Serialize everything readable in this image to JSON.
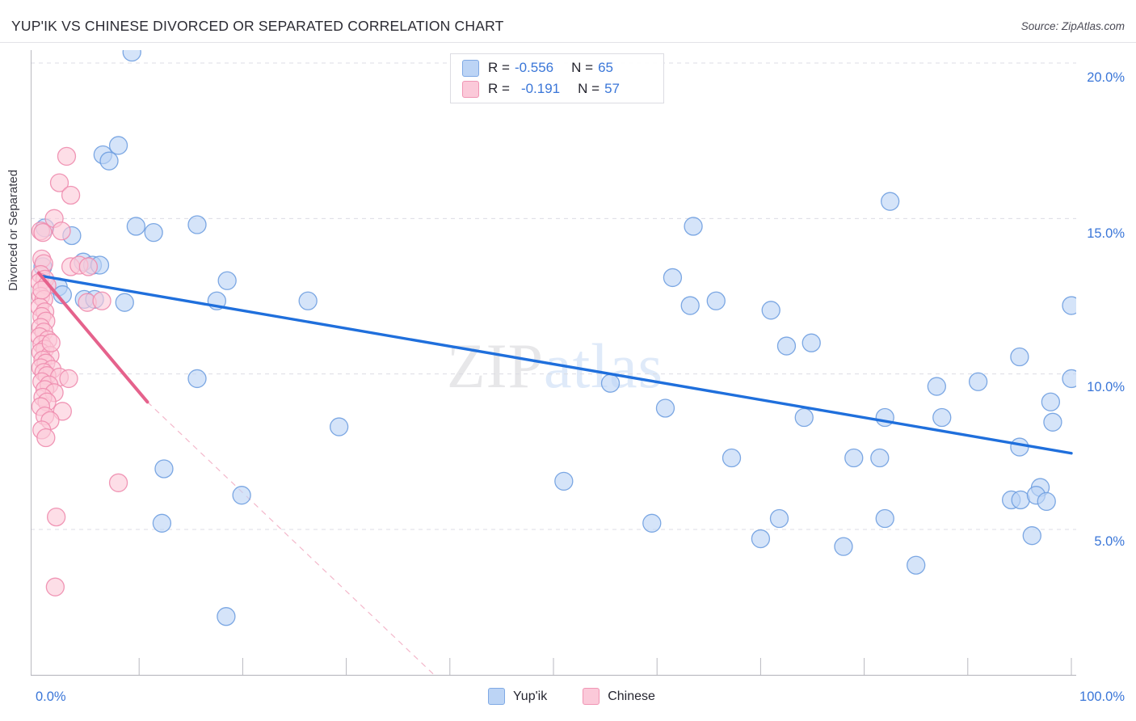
{
  "header": {
    "title": "YUP'IK VS CHINESE DIVORCED OR SEPARATED CORRELATION CHART",
    "source": "Source: ZipAtlas.com"
  },
  "watermark": {
    "part1": "ZIP",
    "part2": "atlas"
  },
  "legend": {
    "rows": [
      {
        "series": "Yup'ik",
        "r_key": "R =",
        "r_value": "-0.556",
        "n_key": "N =",
        "n_value": "65",
        "color": "#bcd4f5"
      },
      {
        "series": "Chinese",
        "r_key": "R =",
        "r_value": "-0.191",
        "n_key": "N =",
        "n_value": "57",
        "color": "#fbc9d9"
      }
    ]
  },
  "bottom_legend": [
    {
      "label": "Yup'ik",
      "color": "#bcd4f5"
    },
    {
      "label": "Chinese",
      "color": "#fbc9d9"
    }
  ],
  "axes": {
    "y_title": "Divorced or Separated",
    "y_ticks": [
      "20.0%",
      "15.0%",
      "10.0%",
      "5.0%"
    ],
    "x_ticks": [
      "0.0%",
      "100.0%"
    ]
  },
  "chart_data": {
    "type": "scatter",
    "title": "YUP'IK VS CHINESE DIVORCED OR SEPARATED CORRELATION CHART",
    "xlabel": "",
    "ylabel": "Divorced or Separated",
    "xlim": [
      0,
      100
    ],
    "ylim": [
      0,
      21.5
    ],
    "x_unit": "%",
    "y_unit": "%",
    "grid": "horizontal-dashed",
    "legend_position": "top-center",
    "y_gridlines": [
      20.0,
      15.0,
      10.0,
      5.0
    ],
    "x_tick_positions": [
      0,
      10,
      20,
      30,
      40,
      50,
      60,
      70,
      80,
      90,
      100
    ],
    "series": [
      {
        "name": "Yup'ik",
        "color": "#bcd4f5",
        "edge": "#6f9fe0",
        "R": -0.556,
        "N": 65,
        "trend": {
          "type": "linear",
          "x0": 0.6,
          "y0": 13.15,
          "x1": 100.0,
          "y1": 7.45,
          "color": "#1f6fdc",
          "dashed_extension": false
        },
        "points": [
          [
            9.3,
            20.35
          ],
          [
            8.0,
            17.35
          ],
          [
            6.5,
            17.05
          ],
          [
            7.1,
            16.85
          ],
          [
            0.9,
            14.7
          ],
          [
            3.5,
            14.45
          ],
          [
            9.7,
            14.75
          ],
          [
            11.4,
            14.55
          ],
          [
            15.6,
            14.8
          ],
          [
            0.7,
            13.45
          ],
          [
            4.6,
            13.6
          ],
          [
            5.5,
            13.5
          ],
          [
            6.2,
            13.5
          ],
          [
            18.5,
            13.0
          ],
          [
            2.2,
            12.8
          ],
          [
            2.6,
            12.55
          ],
          [
            4.7,
            12.4
          ],
          [
            5.7,
            12.4
          ],
          [
            8.6,
            12.3
          ],
          [
            17.5,
            12.35
          ],
          [
            26.3,
            12.35
          ],
          [
            63.5,
            14.75
          ],
          [
            61.5,
            13.1
          ],
          [
            82.5,
            15.55
          ],
          [
            63.2,
            12.2
          ],
          [
            65.7,
            12.35
          ],
          [
            71.0,
            12.05
          ],
          [
            100.0,
            12.2
          ],
          [
            72.5,
            10.9
          ],
          [
            74.9,
            11.0
          ],
          [
            95.0,
            10.55
          ],
          [
            100.0,
            9.85
          ],
          [
            15.6,
            9.85
          ],
          [
            87.0,
            9.6
          ],
          [
            91.0,
            9.75
          ],
          [
            98.0,
            9.1
          ],
          [
            55.5,
            9.7
          ],
          [
            60.8,
            8.9
          ],
          [
            74.2,
            8.6
          ],
          [
            82.0,
            8.6
          ],
          [
            87.5,
            8.6
          ],
          [
            98.2,
            8.45
          ],
          [
            29.3,
            8.3
          ],
          [
            67.2,
            7.3
          ],
          [
            79.0,
            7.3
          ],
          [
            81.5,
            7.3
          ],
          [
            95.0,
            7.65
          ],
          [
            12.4,
            6.95
          ],
          [
            51.0,
            6.55
          ],
          [
            97.0,
            6.35
          ],
          [
            19.9,
            6.1
          ],
          [
            94.2,
            5.95
          ],
          [
            95.1,
            5.95
          ],
          [
            96.6,
            6.1
          ],
          [
            97.6,
            5.9
          ],
          [
            59.5,
            5.2
          ],
          [
            71.8,
            5.35
          ],
          [
            82.0,
            5.35
          ],
          [
            96.2,
            4.8
          ],
          [
            70.0,
            4.7
          ],
          [
            78.0,
            4.45
          ],
          [
            85.0,
            3.85
          ],
          [
            12.2,
            5.2
          ],
          [
            18.4,
            2.2
          ]
        ]
      },
      {
        "name": "Chinese",
        "color": "#fbc9d9",
        "edge": "#ee8cae",
        "R": -0.191,
        "N": 57,
        "trend": {
          "type": "linear",
          "x0": 0.3,
          "y0": 13.25,
          "x1": 10.8,
          "y1": 9.1,
          "color": "#e5628c",
          "dashed_extension": true,
          "dash_x1": 39.5,
          "dash_y1": 0.0
        },
        "points": [
          [
            2.3,
            16.15
          ],
          [
            3.4,
            15.75
          ],
          [
            3.0,
            17.0
          ],
          [
            1.8,
            15.0
          ],
          [
            2.5,
            14.6
          ],
          [
            0.5,
            14.6
          ],
          [
            0.7,
            14.55
          ],
          [
            0.6,
            13.7
          ],
          [
            0.8,
            13.55
          ],
          [
            3.4,
            13.45
          ],
          [
            4.2,
            13.5
          ],
          [
            5.1,
            13.45
          ],
          [
            0.5,
            13.2
          ],
          [
            0.9,
            13.05
          ],
          [
            0.4,
            12.95
          ],
          [
            1.1,
            12.85
          ],
          [
            0.5,
            12.5
          ],
          [
            0.8,
            12.4
          ],
          [
            5.0,
            12.3
          ],
          [
            6.4,
            12.35
          ],
          [
            0.4,
            12.15
          ],
          [
            0.9,
            12.0
          ],
          [
            0.6,
            11.85
          ],
          [
            1.0,
            11.7
          ],
          [
            0.5,
            11.5
          ],
          [
            0.8,
            11.35
          ],
          [
            0.4,
            11.2
          ],
          [
            1.2,
            11.1
          ],
          [
            0.6,
            10.95
          ],
          [
            0.9,
            10.8
          ],
          [
            0.5,
            10.7
          ],
          [
            1.4,
            10.6
          ],
          [
            0.7,
            10.45
          ],
          [
            1.0,
            10.35
          ],
          [
            0.5,
            10.2
          ],
          [
            1.6,
            10.15
          ],
          [
            0.8,
            10.05
          ],
          [
            1.1,
            9.95
          ],
          [
            2.3,
            9.9
          ],
          [
            3.2,
            9.85
          ],
          [
            0.6,
            9.75
          ],
          [
            1.3,
            9.65
          ],
          [
            0.9,
            9.5
          ],
          [
            1.8,
            9.4
          ],
          [
            0.7,
            9.25
          ],
          [
            1.1,
            9.1
          ],
          [
            0.5,
            8.95
          ],
          [
            2.6,
            8.8
          ],
          [
            0.9,
            8.65
          ],
          [
            1.4,
            8.5
          ],
          [
            0.6,
            8.2
          ],
          [
            1.0,
            7.95
          ],
          [
            8.0,
            6.5
          ],
          [
            2.0,
            5.4
          ],
          [
            1.9,
            3.15
          ],
          [
            0.6,
            12.7
          ],
          [
            1.5,
            11.0
          ]
        ]
      }
    ]
  }
}
